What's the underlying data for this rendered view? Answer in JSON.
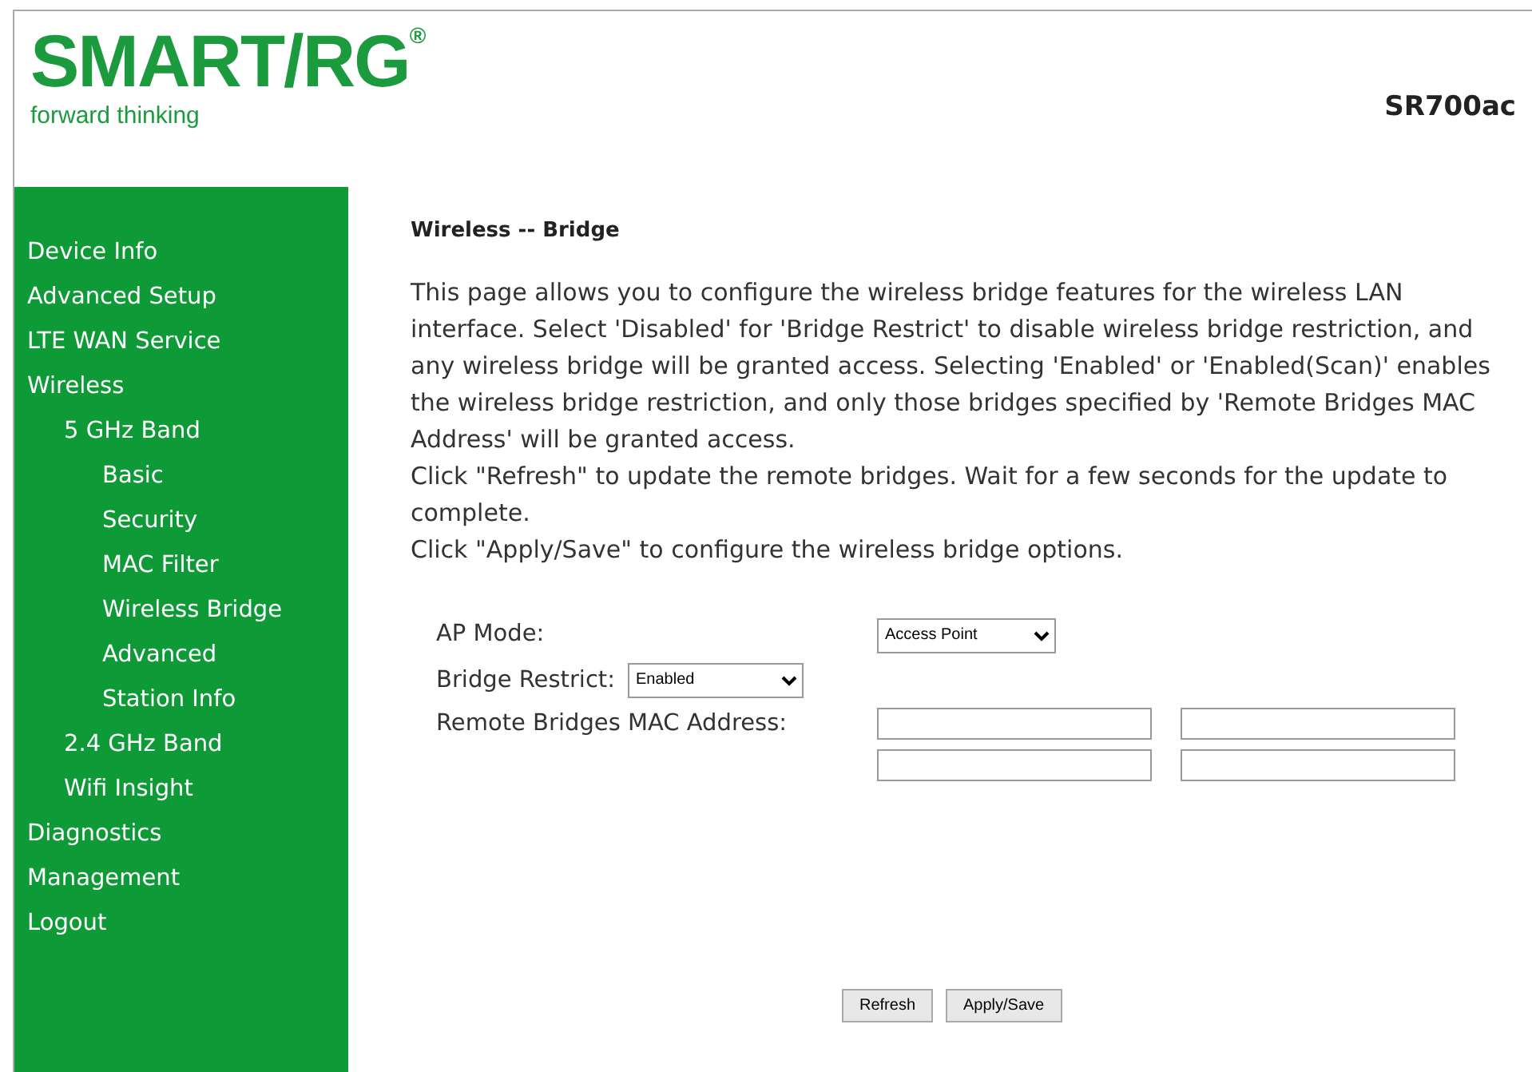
{
  "header": {
    "logo": "SMART/RG",
    "logo_mark": "®",
    "tagline": "forward thinking",
    "model": "SR700ac"
  },
  "sidebar": {
    "items": [
      {
        "label": "Device Info"
      },
      {
        "label": "Advanced Setup"
      },
      {
        "label": "LTE WAN Service"
      },
      {
        "label": "Wireless",
        "children": [
          {
            "label": "5 GHz Band",
            "children": [
              {
                "label": "Basic"
              },
              {
                "label": "Security"
              },
              {
                "label": "MAC Filter"
              },
              {
                "label": "Wireless Bridge"
              },
              {
                "label": "Advanced"
              },
              {
                "label": "Station Info"
              }
            ]
          },
          {
            "label": "2.4 GHz Band"
          },
          {
            "label": "Wifi Insight"
          }
        ]
      },
      {
        "label": "Diagnostics"
      },
      {
        "label": "Management"
      },
      {
        "label": "Logout"
      }
    ]
  },
  "content": {
    "title": "Wireless -- Bridge",
    "paragraphs": [
      "This page allows you to configure the wireless bridge features for the wireless LAN interface. Select 'Disabled' for 'Bridge Restrict' to disable wireless bridge restriction, and any wireless bridge will be granted access. Selecting 'Enabled' or 'Enabled(Scan)' enables the wireless bridge restriction, and only those bridges specified by 'Remote Bridges MAC Address' will be granted access.",
      "Click \"Refresh\" to update the remote bridges. Wait for a few seconds for the update to complete.",
      "Click \"Apply/Save\" to configure the wireless bridge options."
    ],
    "ap_mode": {
      "label": "AP Mode:",
      "value": "Access Point"
    },
    "bridge_restrict": {
      "label": "Bridge Restrict:",
      "value": "Enabled"
    },
    "remote_macs": {
      "label": "Remote Bridges MAC Address:",
      "fields": [
        {
          "kind": "text"
        },
        {
          "kind": "text"
        },
        {
          "kind": "text"
        },
        {
          "kind": "text"
        }
      ]
    },
    "buttons": [
      "Refresh",
      "Apply/Save"
    ]
  }
}
